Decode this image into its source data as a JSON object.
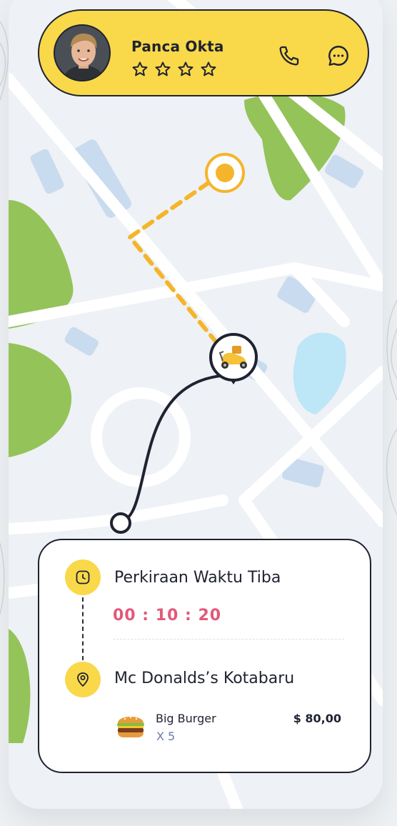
{
  "driver": {
    "name": "Panca Okta",
    "rating_stars": 4,
    "rating_filled": 0,
    "actions": {
      "call_icon": "phone-icon",
      "chat_icon": "chat-bubble-icon"
    }
  },
  "map": {
    "destination_icon": "destination-pin-icon",
    "courier_icon": "scooter-icon",
    "start_icon": "start-point-icon"
  },
  "delivery": {
    "eta_label": "Perkiraan Waktu Tiba",
    "eta_time": "00 : 10 : 20",
    "eta_icon": "clock-icon",
    "place_icon": "location-pin-icon",
    "place_name": "Mc Donalds’s Kotabaru",
    "items": [
      {
        "icon": "burger-icon",
        "name": "Big Burger",
        "quantity": "X 5",
        "price": "$ 80,00"
      }
    ]
  },
  "colors": {
    "accent_yellow": "#f9d84a",
    "route_orange": "#f5b52a",
    "eta_pink": "#e2597a",
    "park_green": "#94c35a",
    "water_blue": "#bde6f7",
    "dark": "#1f2230"
  }
}
